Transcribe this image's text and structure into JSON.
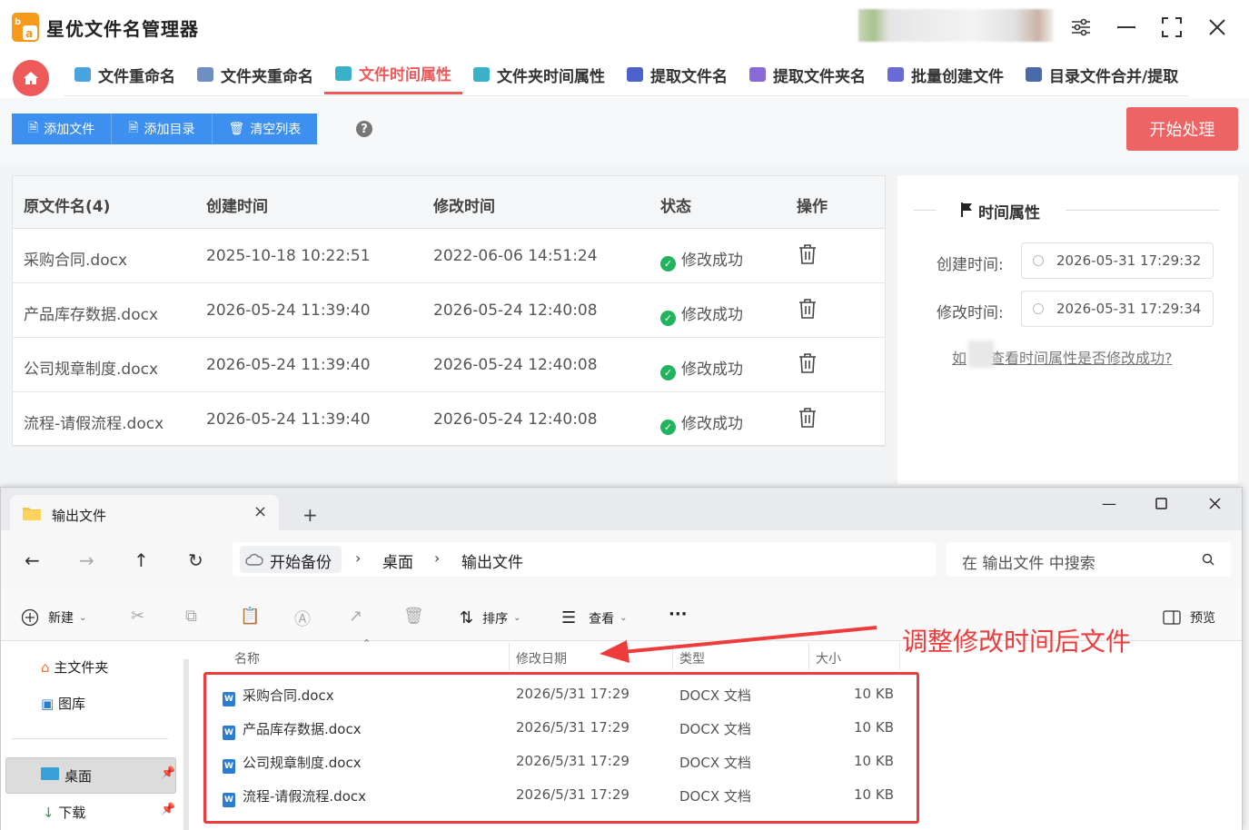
{
  "app": {
    "title": "星优文件名管理器",
    "nav_tabs": [
      {
        "label": "文件重命名",
        "color": "#4aa3df"
      },
      {
        "label": "文件夹重命名",
        "color": "#6f8fc2"
      },
      {
        "label": "文件时间属性",
        "color": "#3bb0c9",
        "active": true
      },
      {
        "label": "文件夹时间属性",
        "color": "#3bb0c9"
      },
      {
        "label": "提取文件名",
        "color": "#4a62c9"
      },
      {
        "label": "提取文件夹名",
        "color": "#8a6bd6"
      },
      {
        "label": "批量创建文件",
        "color": "#6a6ad6"
      },
      {
        "label": "目录文件合并/提取",
        "color": "#4a6aa9"
      }
    ],
    "toolbar": {
      "add_file": "添加文件",
      "add_dir": "添加目录",
      "clear_list": "清空列表",
      "help": "?",
      "start": "开始处理"
    },
    "table": {
      "headers": [
        "原文件名(4)",
        "创建时间",
        "修改时间",
        "状态",
        "操作"
      ],
      "rows": [
        {
          "name": "采购合同.docx",
          "created": "2025-10-18 10:22:51",
          "modified": "2022-06-06 14:51:24",
          "status": "修改成功"
        },
        {
          "name": "产品库存数据.docx",
          "created": "2026-05-24 11:39:40",
          "modified": "2026-05-24 12:40:08",
          "status": "修改成功"
        },
        {
          "name": "公司规章制度.docx",
          "created": "2026-05-24 11:39:40",
          "modified": "2026-05-24 12:40:08",
          "status": "修改成功"
        },
        {
          "name": "流程-请假流程.docx",
          "created": "2026-05-24 11:39:40",
          "modified": "2026-05-24 12:40:08",
          "status": "修改成功"
        }
      ]
    },
    "side": {
      "title": "时间属性",
      "created_label": "创建时间:",
      "created_value": "2026-05-31 17:29:32",
      "modified_label": "修改时间:",
      "modified_value": "2026-05-31 17:29:34",
      "help_link_pre": "如",
      "help_link": "查看时间属性是否修改成功?"
    }
  },
  "explorer": {
    "tab_title": "输出文件",
    "breadcrumb": [
      "开始备份",
      "桌面",
      "输出文件"
    ],
    "search_placeholder": "在 输出文件 中搜索",
    "cmd": {
      "new": "新建",
      "sort": "排序",
      "view": "查看",
      "more": "···",
      "preview": "预览"
    },
    "nav": {
      "home": "主文件夹",
      "gallery": "图库",
      "desktop": "桌面",
      "downloads": "下载"
    },
    "columns": [
      "名称",
      "修改日期",
      "类型",
      "大小"
    ],
    "files": [
      {
        "name": "采购合同.docx",
        "date": "2026/5/31 17:29",
        "type": "DOCX 文档",
        "size": "10 KB"
      },
      {
        "name": "产品库存数据.docx",
        "date": "2026/5/31 17:29",
        "type": "DOCX 文档",
        "size": "10 KB"
      },
      {
        "name": "公司规章制度.docx",
        "date": "2026/5/31 17:29",
        "type": "DOCX 文档",
        "size": "10 KB"
      },
      {
        "name": "流程-请假流程.docx",
        "date": "2026/5/31 17:29",
        "type": "DOCX 文档",
        "size": "10 KB"
      }
    ]
  },
  "annotation": "调整修改时间后文件",
  "colors": {
    "accent": "#ee5a5a",
    "primary": "#3d8ff0",
    "success": "#22b35e",
    "highlight": "#ee3b3b"
  }
}
